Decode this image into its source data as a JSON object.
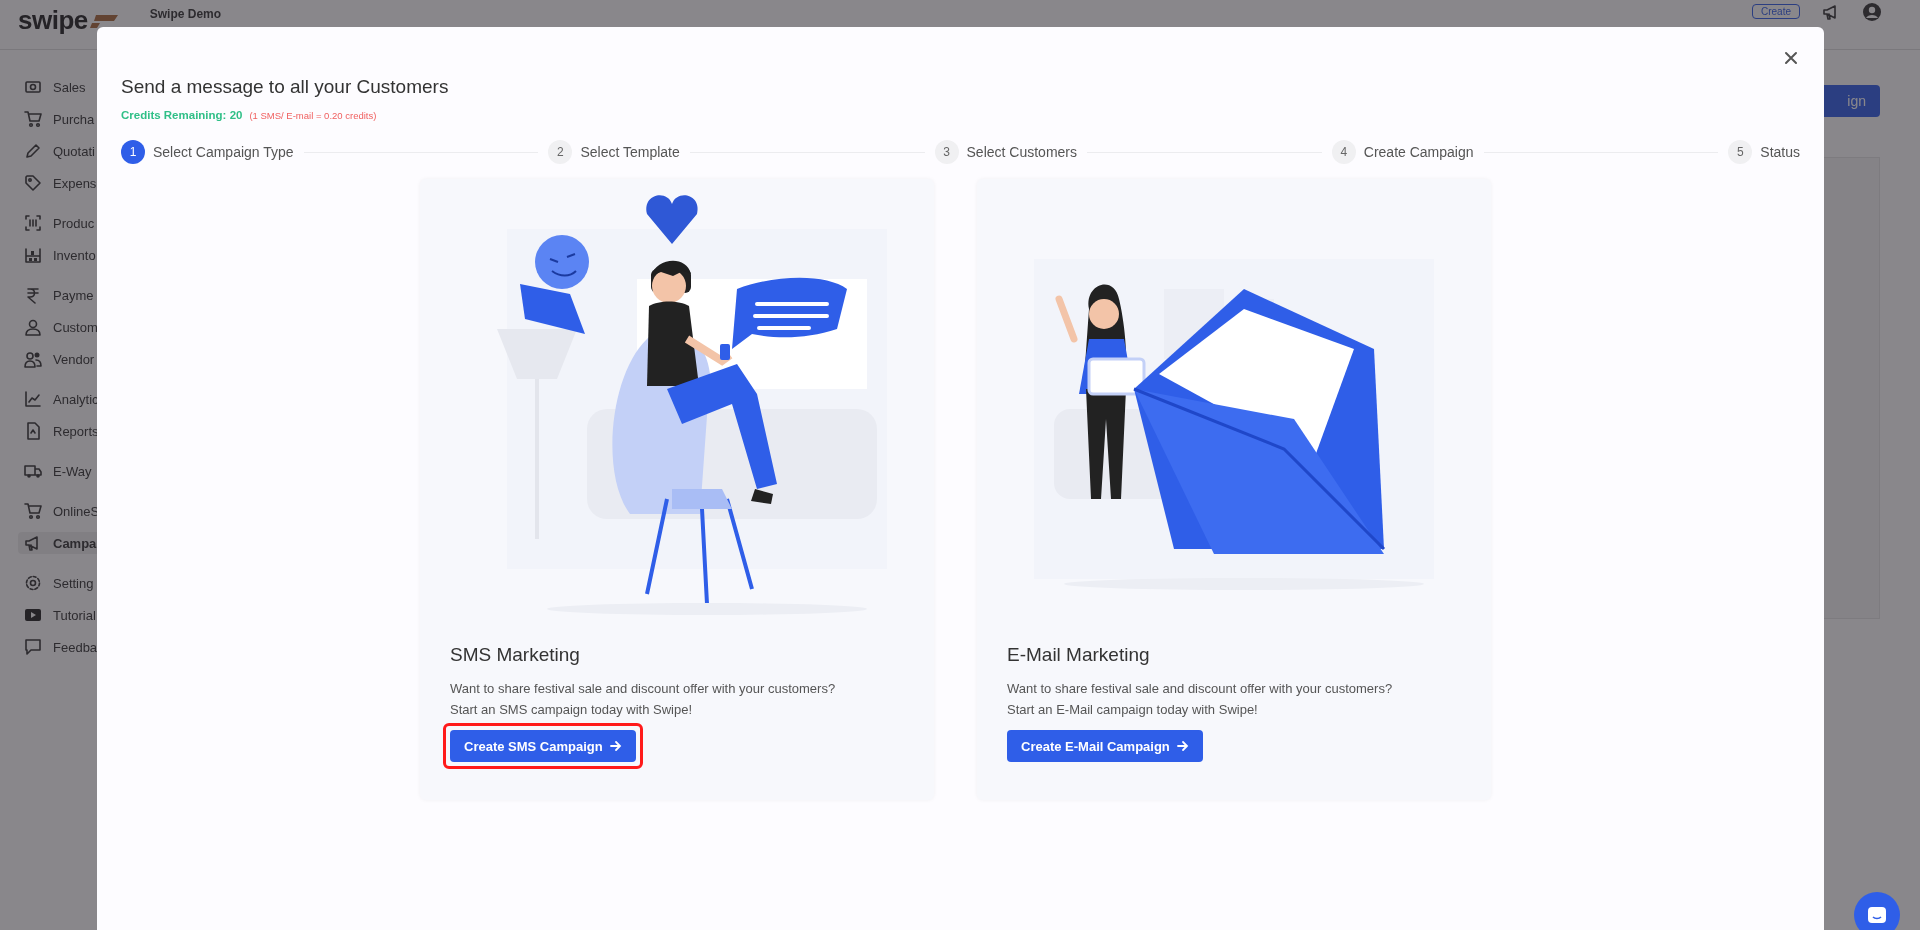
{
  "header": {
    "logo": "swipe",
    "company": "Swipe Demo",
    "create_button": "Create",
    "behind_button": "ign"
  },
  "sidebar": {
    "groups": [
      {
        "items": [
          {
            "label": "Sales",
            "kind": "cash",
            "selected": false
          },
          {
            "label": "Purcha",
            "kind": "cart",
            "selected": false
          },
          {
            "label": "Quotati",
            "kind": "pencil",
            "selected": false
          },
          {
            "label": "Expens",
            "kind": "tag",
            "selected": false
          }
        ]
      },
      {
        "items": [
          {
            "label": "Produc",
            "kind": "barcode",
            "selected": false
          },
          {
            "label": "Invento",
            "kind": "shelf",
            "selected": false
          }
        ]
      },
      {
        "items": [
          {
            "label": "Payme",
            "kind": "rupee",
            "selected": false
          },
          {
            "label": "Custom",
            "kind": "user",
            "selected": false
          },
          {
            "label": "Vendor",
            "kind": "users",
            "selected": false
          }
        ]
      },
      {
        "items": [
          {
            "label": "Analytic",
            "kind": "chart",
            "selected": false
          },
          {
            "label": "Reports",
            "kind": "doc",
            "selected": false
          }
        ]
      },
      {
        "items": [
          {
            "label": "E-Way",
            "kind": "truck",
            "selected": false
          }
        ]
      },
      {
        "items": [
          {
            "label": "OnlineS",
            "kind": "cart",
            "selected": false
          },
          {
            "label": "Campa",
            "kind": "megaphone",
            "selected": true
          }
        ]
      },
      {
        "items": [
          {
            "label": "Setting",
            "kind": "gear",
            "selected": false
          },
          {
            "label": "Tutorial",
            "kind": "video",
            "selected": false
          },
          {
            "label": "Feedba",
            "kind": "chat",
            "selected": false
          }
        ]
      }
    ]
  },
  "modal": {
    "title": "Send a message to all your Customers",
    "credits": "Credits Remaining: 20",
    "credits_note": "(1 SMS/ E-mail = 0.20 credits)",
    "steps": [
      {
        "number": "1",
        "label": "Select Campaign Type",
        "selected": true
      },
      {
        "number": "2",
        "label": "Select Template",
        "selected": false
      },
      {
        "number": "3",
        "label": "Select Customers",
        "selected": false
      },
      {
        "number": "4",
        "label": "Create Campaign",
        "selected": false
      },
      {
        "number": "5",
        "label": "Status",
        "selected": false
      }
    ],
    "cards": [
      {
        "kind": "sms",
        "title": "SMS Marketing",
        "description": [
          "Want to share festival sale and discount offer with your customers?",
          "Start an SMS campaign today with Swipe!"
        ],
        "button": {
          "label": "Create SMS Campaign",
          "highlighted": true
        }
      },
      {
        "kind": "email",
        "title": "E-Mail Marketing",
        "description": [
          "Want to share festival sale and discount offer with your customers?",
          "Start an E-Mail campaign today with Swipe!"
        ],
        "button": {
          "label": "Create E-Mail Campaign",
          "highlighted": false
        }
      }
    ]
  }
}
